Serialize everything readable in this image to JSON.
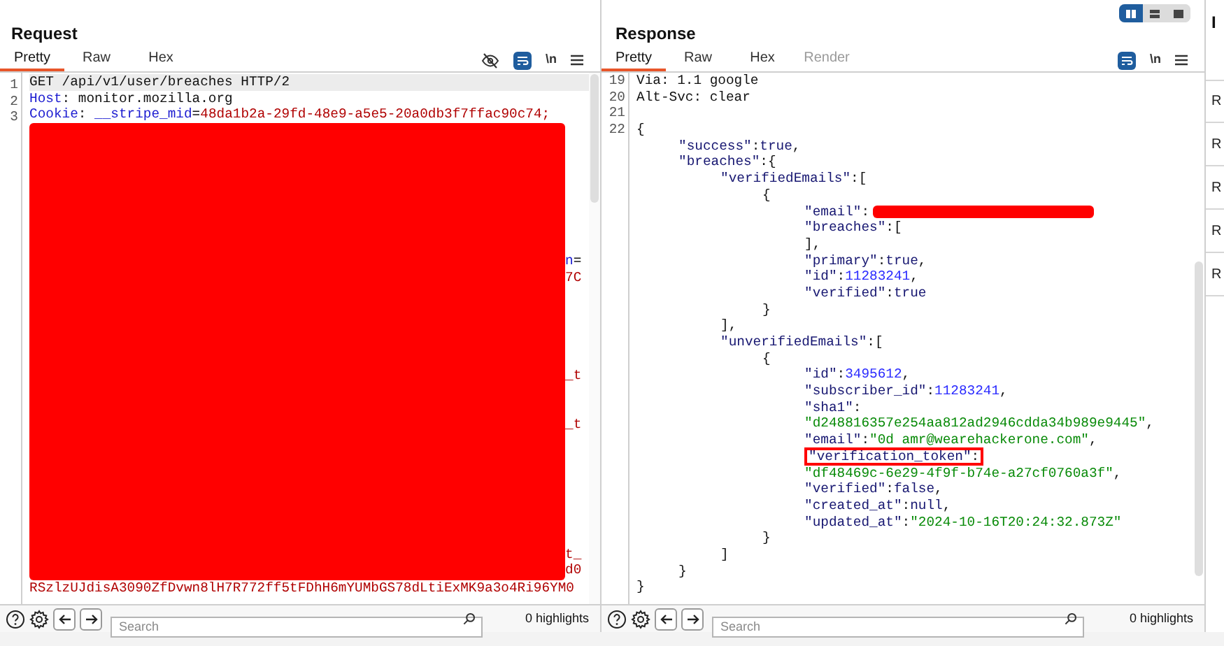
{
  "request": {
    "title": "Request",
    "tabs": [
      {
        "label": "Pretty",
        "selected": true
      },
      {
        "label": "Raw",
        "selected": false
      },
      {
        "label": "Hex",
        "selected": false
      }
    ],
    "toolbar": {
      "newline_label": "\\n"
    },
    "lines": [
      {
        "number": "1",
        "current": true,
        "tokens": [
          {
            "t": "GET /api/v1/user/breaches HTTP/2",
            "kind": "plain"
          }
        ]
      },
      {
        "number": "2",
        "current": false,
        "tokens": [
          {
            "t": "Host",
            "kind": "name"
          },
          {
            "t": ": monitor.mozilla.org",
            "kind": "plain"
          }
        ]
      },
      {
        "number": "3",
        "current": false,
        "tokens": [
          {
            "t": "Cookie",
            "kind": "name"
          },
          {
            "t": ": ",
            "kind": "plain"
          },
          {
            "t": "__stripe_mid",
            "kind": "name"
          },
          {
            "t": "=",
            "kind": "plain"
          },
          {
            "t": "48da1b2a-29fd-48e9-a5e5-20a0db3f7ffac90c74;",
            "kind": "value"
          }
        ]
      }
    ],
    "redacted_fragments": [
      {
        "tokens": [
          {
            "t": "n",
            "kind": "name"
          },
          {
            "t": "=",
            "kind": "plain"
          }
        ]
      },
      {
        "tokens": [
          {
            "t": "7C",
            "kind": "value"
          }
        ]
      },
      {
        "tokens": [
          {
            "t": "_t",
            "kind": "value"
          }
        ]
      },
      {
        "tokens": [
          {
            "t": "_t",
            "kind": "value"
          }
        ]
      },
      {
        "tokens": [
          {
            "t": "t_",
            "kind": "value"
          }
        ]
      },
      {
        "tokens": [
          {
            "t": "d0",
            "kind": "value"
          }
        ]
      }
    ],
    "last_line": {
      "tokens": [
        {
          "t": "RSzlzUJdisA3090ZfDvwn8lH7R772ff5tFDhH6mYUMbGS78dLtiExMK9a3o4Ri96YM0",
          "kind": "value"
        }
      ]
    },
    "footer": {
      "search_placeholder": "Search",
      "highlights": "0 highlights"
    }
  },
  "response": {
    "title": "Response",
    "layout_buttons": [
      {
        "selected": true
      },
      {
        "selected": false
      },
      {
        "selected": false
      }
    ],
    "tabs": [
      {
        "label": "Pretty",
        "selected": true,
        "disabled": false
      },
      {
        "label": "Raw",
        "selected": false,
        "disabled": false
      },
      {
        "label": "Hex",
        "selected": false,
        "disabled": false
      },
      {
        "label": "Render",
        "selected": false,
        "disabled": true
      }
    ],
    "toolbar": {
      "newline_label": "\\n"
    },
    "header_lines": [
      {
        "number": "19",
        "tokens": [
          {
            "t": "Via: 1.1 google",
            "kind": "plain"
          }
        ]
      },
      {
        "number": "20",
        "tokens": [
          {
            "t": "Alt-Svc: clear",
            "kind": "plain"
          }
        ]
      },
      {
        "number": "21"
      }
    ],
    "body_number": "22",
    "body": [
      {
        "tokens": [
          {
            "t": "{",
            "kind": "plain"
          }
        ],
        "children": [
          {
            "tokens": [
              {
                "t": "\"success\"",
                "kind": "key"
              },
              {
                "t": ":",
                "kind": "plain"
              },
              {
                "t": "true",
                "kind": "literal"
              },
              {
                "t": ",",
                "kind": "plain"
              }
            ]
          },
          {
            "tokens": [
              {
                "t": "\"breaches\"",
                "kind": "key"
              },
              {
                "t": ":{",
                "kind": "plain"
              }
            ],
            "children": [
              {
                "tokens": [
                  {
                    "t": "\"verifiedEmails\"",
                    "kind": "key"
                  },
                  {
                    "t": ":[",
                    "kind": "plain"
                  }
                ],
                "children": [
                  {
                    "tokens": [
                      {
                        "t": "{",
                        "kind": "plain"
                      }
                    ],
                    "children": [
                      {
                        "redacted": true,
                        "tokens": [
                          {
                            "t": "\"email\"",
                            "kind": "key"
                          },
                          {
                            "t": ":",
                            "kind": "plain"
                          }
                        ]
                      },
                      {
                        "tokens": [
                          {
                            "t": "\"breaches\"",
                            "kind": "key"
                          },
                          {
                            "t": ":[",
                            "kind": "plain"
                          }
                        ]
                      },
                      {
                        "tokens": [
                          {
                            "t": "],",
                            "kind": "plain"
                          }
                        ]
                      },
                      {
                        "tokens": [
                          {
                            "t": "\"primary\"",
                            "kind": "key"
                          },
                          {
                            "t": ":",
                            "kind": "plain"
                          },
                          {
                            "t": "true",
                            "kind": "literal"
                          },
                          {
                            "t": ",",
                            "kind": "plain"
                          }
                        ]
                      },
                      {
                        "tokens": [
                          {
                            "t": "\"id\"",
                            "kind": "key"
                          },
                          {
                            "t": ":",
                            "kind": "plain"
                          },
                          {
                            "t": "11283241",
                            "kind": "number"
                          },
                          {
                            "t": ",",
                            "kind": "plain"
                          }
                        ]
                      },
                      {
                        "tokens": [
                          {
                            "t": "\"verified\"",
                            "kind": "key"
                          },
                          {
                            "t": ":",
                            "kind": "plain"
                          },
                          {
                            "t": "true",
                            "kind": "literal"
                          }
                        ]
                      }
                    ]
                  },
                  {
                    "tokens": [
                      {
                        "t": "}",
                        "kind": "plain"
                      }
                    ]
                  }
                ]
              },
              {
                "tokens": [
                  {
                    "t": "],",
                    "kind": "plain"
                  }
                ]
              },
              {
                "tokens": [
                  {
                    "t": "\"unverifiedEmails\"",
                    "kind": "key"
                  },
                  {
                    "t": ":[",
                    "kind": "plain"
                  }
                ],
                "children": [
                  {
                    "tokens": [
                      {
                        "t": "{",
                        "kind": "plain"
                      }
                    ],
                    "children": [
                      {
                        "tokens": [
                          {
                            "t": "\"id\"",
                            "kind": "key"
                          },
                          {
                            "t": ":",
                            "kind": "plain"
                          },
                          {
                            "t": "3495612",
                            "kind": "number"
                          },
                          {
                            "t": ",",
                            "kind": "plain"
                          }
                        ]
                      },
                      {
                        "tokens": [
                          {
                            "t": "\"subscriber_id\"",
                            "kind": "key"
                          },
                          {
                            "t": ":",
                            "kind": "plain"
                          },
                          {
                            "t": "11283241",
                            "kind": "number"
                          },
                          {
                            "t": ",",
                            "kind": "plain"
                          }
                        ]
                      },
                      {
                        "tokens": [
                          {
                            "t": "\"sha1\"",
                            "kind": "key"
                          },
                          {
                            "t": ":",
                            "kind": "plain"
                          }
                        ]
                      },
                      {
                        "tokens": [
                          {
                            "t": "\"d248816357e254aa812ad2946cdda34b989e9445\"",
                            "kind": "string"
                          },
                          {
                            "t": ",",
                            "kind": "plain"
                          }
                        ]
                      },
                      {
                        "tokens": [
                          {
                            "t": "\"email\"",
                            "kind": "key"
                          },
                          {
                            "t": ":",
                            "kind": "plain"
                          },
                          {
                            "t": "\"0d amr@wearehackerone.com\"",
                            "kind": "string"
                          },
                          {
                            "t": ",",
                            "kind": "plain"
                          }
                        ]
                      },
                      {
                        "boxed": true,
                        "tokens": [
                          {
                            "t": "\"verification_token\"",
                            "kind": "key"
                          },
                          {
                            "t": ":",
                            "kind": "plain"
                          }
                        ]
                      },
                      {
                        "tokens": [
                          {
                            "t": "\"df48469c-6e29-4f9f-b74e-a27cf0760a3f\"",
                            "kind": "string"
                          },
                          {
                            "t": ",",
                            "kind": "plain"
                          }
                        ]
                      },
                      {
                        "tokens": [
                          {
                            "t": "\"verified\"",
                            "kind": "key"
                          },
                          {
                            "t": ":",
                            "kind": "plain"
                          },
                          {
                            "t": "false",
                            "kind": "literal"
                          },
                          {
                            "t": ",",
                            "kind": "plain"
                          }
                        ]
                      },
                      {
                        "tokens": [
                          {
                            "t": "\"created_at\"",
                            "kind": "key"
                          },
                          {
                            "t": ":",
                            "kind": "plain"
                          },
                          {
                            "t": "null",
                            "kind": "literal"
                          },
                          {
                            "t": ",",
                            "kind": "plain"
                          }
                        ]
                      },
                      {
                        "tokens": [
                          {
                            "t": "\"updated_at\"",
                            "kind": "key"
                          },
                          {
                            "t": ":",
                            "kind": "plain"
                          },
                          {
                            "t": "\"2024-10-16T20:24:32.873Z\"",
                            "kind": "string"
                          }
                        ]
                      }
                    ]
                  },
                  {
                    "tokens": [
                      {
                        "t": "}",
                        "kind": "plain"
                      }
                    ]
                  }
                ]
              },
              {
                "tokens": [
                  {
                    "t": "]",
                    "kind": "plain"
                  }
                ]
              }
            ]
          },
          {
            "tokens": [
              {
                "t": "}",
                "kind": "plain"
              }
            ]
          }
        ]
      },
      {
        "tokens": [
          {
            "t": "}",
            "kind": "plain"
          }
        ]
      }
    ],
    "footer": {
      "search_placeholder": "Search",
      "highlights": "0 highlights"
    }
  },
  "side_panel": {
    "header": "I",
    "items": [
      "R",
      "R",
      "R",
      "R",
      "R"
    ]
  }
}
